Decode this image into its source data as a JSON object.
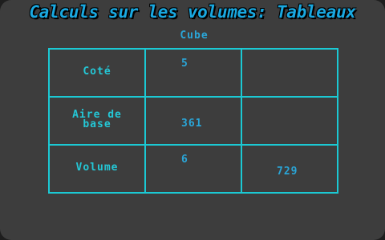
{
  "title": "Calculs sur les volumes: Tableaux",
  "subtitle": "Cube",
  "table": {
    "rows": [
      {
        "label": "Coté",
        "value1": "5",
        "value2": ""
      },
      {
        "label": "Aire de base",
        "label_line1": "Aire de",
        "label_line2": "base",
        "value1": "361",
        "value2": ""
      },
      {
        "label": "Volume",
        "value1": "6",
        "value2": "729"
      }
    ]
  },
  "colors": {
    "background": "#3d3d3d",
    "grid_lines": "#1bc9d4",
    "text": "#2aa6d8",
    "title": "#19a8e0"
  }
}
